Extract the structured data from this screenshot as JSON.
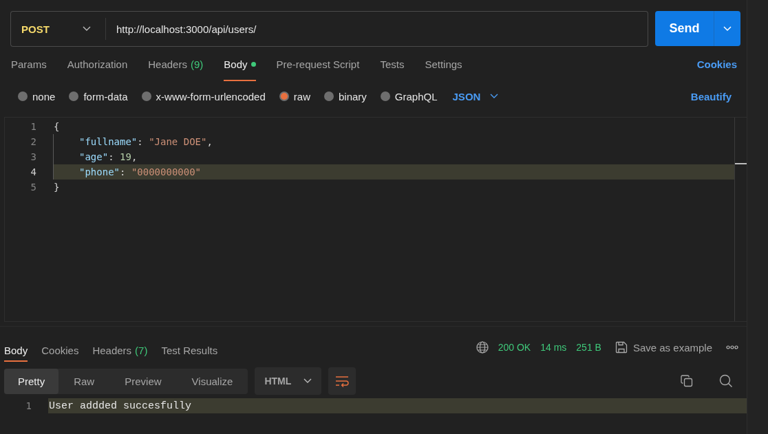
{
  "request": {
    "method": "POST",
    "url": "http://localhost:3000/api/users/",
    "send_label": "Send"
  },
  "request_tabs": [
    {
      "label": "Params",
      "selected": false,
      "modified": false
    },
    {
      "label": "Authorization",
      "selected": false,
      "modified": false
    },
    {
      "label": "Headers",
      "count": "(9)",
      "selected": false,
      "modified": false
    },
    {
      "label": "Body",
      "selected": true,
      "modified": true
    },
    {
      "label": "Pre-request Script",
      "selected": false,
      "modified": false
    },
    {
      "label": "Tests",
      "selected": false,
      "modified": false
    },
    {
      "label": "Settings",
      "selected": false,
      "modified": false
    }
  ],
  "cookies_link": "Cookies",
  "body_types": [
    {
      "label": "none",
      "selected": false
    },
    {
      "label": "form-data",
      "selected": false
    },
    {
      "label": "x-www-form-urlencoded",
      "selected": false
    },
    {
      "label": "raw",
      "selected": true
    },
    {
      "label": "binary",
      "selected": false
    },
    {
      "label": "GraphQL",
      "selected": false
    }
  ],
  "format": "JSON",
  "beautify_link": "Beautify",
  "editor_lines": [
    {
      "number": "1",
      "current": false,
      "indent": false,
      "tokens": [
        {
          "kind": "punct",
          "text": "{"
        }
      ]
    },
    {
      "number": "2",
      "current": false,
      "indent": true,
      "tokens": [
        {
          "kind": "key",
          "text": "\"fullname\""
        },
        {
          "kind": "punct",
          "text": ": "
        },
        {
          "kind": "string",
          "text": "\"Jane DOE\""
        },
        {
          "kind": "punct",
          "text": ","
        }
      ]
    },
    {
      "number": "3",
      "current": false,
      "indent": true,
      "tokens": [
        {
          "kind": "key",
          "text": "\"age\""
        },
        {
          "kind": "punct",
          "text": ": "
        },
        {
          "kind": "number",
          "text": "19"
        },
        {
          "kind": "punct",
          "text": ","
        }
      ]
    },
    {
      "number": "4",
      "current": true,
      "indent": true,
      "tokens": [
        {
          "kind": "key",
          "text": "\"phone\""
        },
        {
          "kind": "punct",
          "text": ": "
        },
        {
          "kind": "string",
          "text": "\"0000000000\""
        }
      ]
    },
    {
      "number": "5",
      "current": false,
      "indent": false,
      "tokens": [
        {
          "kind": "punct",
          "text": "}"
        }
      ]
    }
  ],
  "response_tabs": [
    {
      "label": "Body",
      "selected": true
    },
    {
      "label": "Cookies",
      "selected": false
    },
    {
      "label": "Headers",
      "count": "(7)",
      "selected": false
    },
    {
      "label": "Test Results",
      "selected": false
    }
  ],
  "response_status": {
    "status": "200 OK",
    "time": "14 ms",
    "size": "251 B"
  },
  "save_example": "Save as example",
  "view_modes": [
    {
      "label": "Pretty",
      "selected": true
    },
    {
      "label": "Raw",
      "selected": false
    },
    {
      "label": "Preview",
      "selected": false
    },
    {
      "label": "Visualize",
      "selected": false
    }
  ],
  "response_format": "HTML",
  "response_lines": [
    {
      "number": "1",
      "current": true,
      "text": "User addded succesfully"
    }
  ]
}
